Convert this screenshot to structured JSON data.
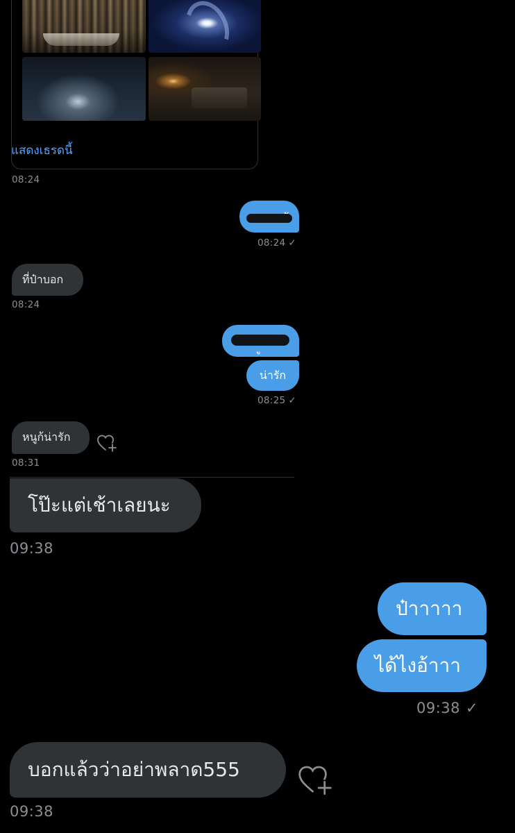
{
  "thread_card": {
    "show_thread_label": "แสดงเธรดนี้",
    "images": [
      "bar-photo",
      "moon-photo",
      "sea-photo",
      "room-photo"
    ]
  },
  "messages": [
    {
      "id": "m1",
      "direction": "incoming",
      "time": "08:24"
    },
    {
      "id": "m2",
      "direction": "outgoing",
      "text_fragment": "ะ",
      "time": "08:24",
      "redacted": true
    },
    {
      "id": "m3",
      "direction": "incoming",
      "text": "ที่ป๋าบอก",
      "time": "08:24"
    },
    {
      "id": "m4",
      "direction": "outgoing",
      "text_fragment": "ู",
      "redacted": true
    },
    {
      "id": "m5",
      "direction": "outgoing",
      "text": "น่ารัก",
      "time": "08:25"
    },
    {
      "id": "m6",
      "direction": "incoming",
      "text": "หนูก้น่ารัก",
      "time": "08:31"
    },
    {
      "id": "m7",
      "direction": "incoming",
      "text": "โป๊ะแต่เช้าเลยนะ",
      "time": "09:38"
    },
    {
      "id": "m8",
      "direction": "outgoing",
      "text": "ป๋าาาาา"
    },
    {
      "id": "m9",
      "direction": "outgoing",
      "text": "ได้ไงอ้าาา",
      "time": "09:38"
    },
    {
      "id": "m10",
      "direction": "incoming",
      "text": "บอกแล้วว่าอย่าพลาด555",
      "time": "09:38"
    }
  ],
  "icons": {
    "read_receipt": "check-icon",
    "react": "heart-plus-icon"
  },
  "colors": {
    "background": "#000000",
    "incoming_bubble": "#2f3336",
    "outgoing_bubble": "#4a9ee8",
    "link": "#4ea3ff",
    "timestamp": "#8b8f94"
  }
}
